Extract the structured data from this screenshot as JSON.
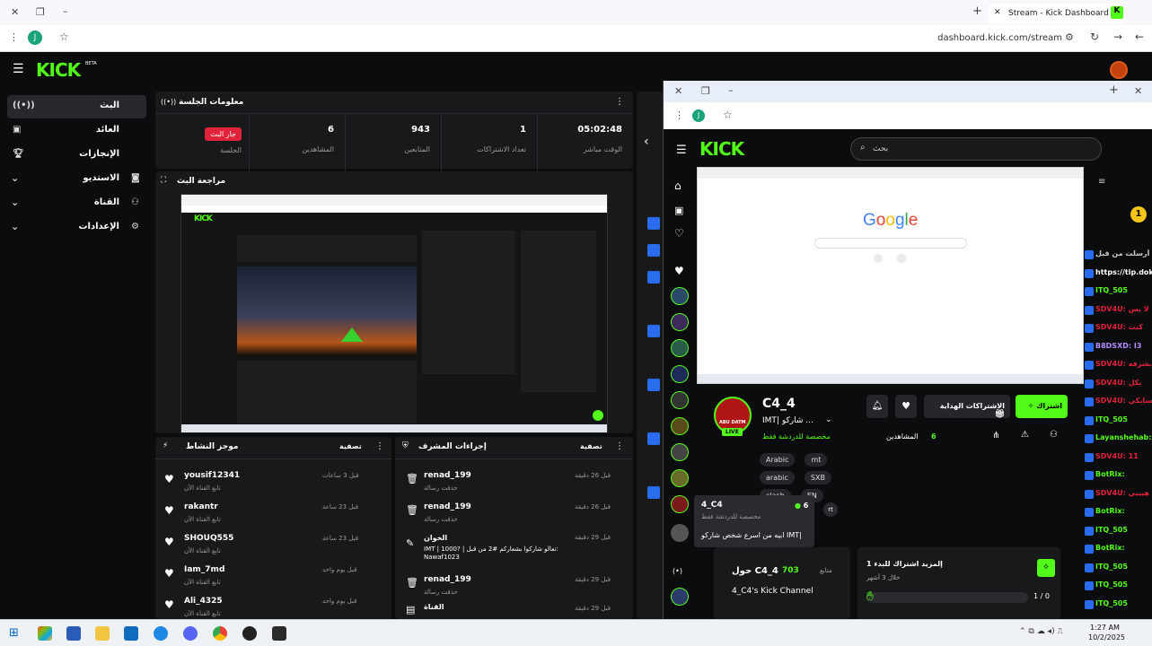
{
  "browser": {
    "tab_title": "Stream - Kick Dashboard",
    "url": "dashboard.kick.com/stream"
  },
  "brand": {
    "logo": "KICK",
    "beta": "BETA",
    "accent": "#53fc18"
  },
  "sidebar": {
    "items": [
      {
        "label": "البث",
        "icon": "broadcast-icon"
      },
      {
        "label": "العائد",
        "icon": "revenue-icon"
      },
      {
        "label": "الإنجازات",
        "icon": "trophy-icon"
      },
      {
        "label": "الاستديو",
        "icon": "studio-icon"
      },
      {
        "label": "القناة",
        "icon": "channel-icon"
      },
      {
        "label": "الإعدادات",
        "icon": "gear-icon"
      }
    ]
  },
  "session": {
    "title": "معلومات الجلسة",
    "live_badge": "جار البث",
    "live_label": "الجلسة",
    "stats": [
      {
        "value": "6",
        "label": "المشاهدين"
      },
      {
        "value": "943",
        "label": "المتابعين"
      },
      {
        "value": "1",
        "label": "تعداد الاشتراكات"
      },
      {
        "value": "05:02:48",
        "label": "الوقت مباشر"
      }
    ]
  },
  "preview": {
    "title": "مراجعة البث"
  },
  "activity": {
    "title": "موجز النشاط",
    "filter": "تصفية",
    "rows": [
      {
        "user": "yousif12341",
        "action": "تابع القناة الآن",
        "time": "قبل 3 ساعات"
      },
      {
        "user": "rakantr",
        "action": "تابع القناة الآن",
        "time": "قبل 23 ساعة"
      },
      {
        "user": "SHOUQ555",
        "action": "تابع القناة الآن",
        "time": "قبل 23 ساعة"
      },
      {
        "user": "Iam_7md",
        "action": "تابع القناة الآن",
        "time": "قبل يوم واحد"
      },
      {
        "user": "Ali_4325",
        "action": "تابع القناة الآن",
        "time": "قبل يوم واحد"
      }
    ]
  },
  "modactions": {
    "title": "إجراءات المشرف",
    "filter": "تصفية",
    "rows": [
      {
        "user": "renad_199",
        "action": "حذفت رسالة",
        "time": "قبل 26 دقيقة"
      },
      {
        "user": "renad_199",
        "action": "حذفت رسالة",
        "time": "قبل 26 دقيقة"
      },
      {
        "user": "الخوان",
        "action": "IMT | 1000? | تعالو شاركوا بشعاركم #2 من قبل: Nawaf1023",
        "time": "قبل 29 دقيقة"
      },
      {
        "user": "renad_199",
        "action": "حذفت رسالة",
        "time": "قبل 29 دقيقة"
      },
      {
        "user": "القناة",
        "action": "",
        "time": "قبل 29 دقيقة"
      }
    ]
  },
  "popup": {
    "search_placeholder": "بحث",
    "google": "Google",
    "streamer": {
      "name": "C4_4",
      "subtitle": "IMT| شاركو ...",
      "tag": "مخصصة للدردشة فقط",
      "live": "LIVE",
      "avatar_text": "ABU DATM",
      "viewers_label": "المشاهدين",
      "viewers": "6"
    },
    "buttons": {
      "subscribe": "اشتراك",
      "gift": "الاشتراكات الهداية"
    },
    "tags": [
      "Arabic",
      "mt",
      "arabic",
      "SXB",
      "clash",
      "EN"
    ],
    "tooltip": {
      "name": "4_C4",
      "count": "6",
      "tag": "مخصصة للدردشة فقط",
      "line": "ابيه من اسرع شخص شاركو IMT|"
    },
    "about": {
      "followers": "703",
      "followers_label": "متابع",
      "title": "حول C4_4",
      "channel": "4_C4's Kick Channel"
    },
    "sub_card": {
      "title": "إلمزيد اشتراك للبدء 1",
      "sub": "خلال 3 أشهر",
      "progress": "1 / 0",
      "progress_fraction": 0.0
    }
  },
  "chat": [
    {
      "name": "أرسلت من قبل",
      "color": "#cccccc"
    },
    {
      "name": "https://tip.dok",
      "color": "#ffffff"
    },
    {
      "name": "ITQ_505",
      "color": "#53fc18"
    },
    {
      "name": "SDV4U: لا بس",
      "color": "#e0223a"
    },
    {
      "name": "SDV4U: كنت",
      "color": "#e0223a"
    },
    {
      "name": "B8DSXD: I3",
      "color": "#b48cff"
    },
    {
      "name": "SDV4U: بشرفه",
      "color": "#e0223a"
    },
    {
      "name": "SDV4U: بكل",
      "color": "#e0223a"
    },
    {
      "name": "SDV4U: حسابكي",
      "color": "#e0223a"
    },
    {
      "name": "ITQ_505",
      "color": "#53fc18"
    },
    {
      "name": "Layanshehab:",
      "color": "#53fc18"
    },
    {
      "name": "SDV4U: 11",
      "color": "#e0223a"
    },
    {
      "name": "BotRix:",
      "color": "#53fc18"
    },
    {
      "name": "SDV4U: هيييي",
      "color": "#e0223a"
    },
    {
      "name": "BotRix:",
      "color": "#53fc18"
    },
    {
      "name": "ITQ_505",
      "color": "#53fc18"
    },
    {
      "name": "BotRix:",
      "color": "#53fc18"
    },
    {
      "name": "ITQ_505",
      "color": "#53fc18"
    },
    {
      "name": "ITQ_505",
      "color": "#53fc18"
    },
    {
      "name": "ITQ_505",
      "color": "#53fc18"
    }
  ],
  "taskbar": {
    "time": "1:27 AM",
    "date": "10/2/2025"
  }
}
